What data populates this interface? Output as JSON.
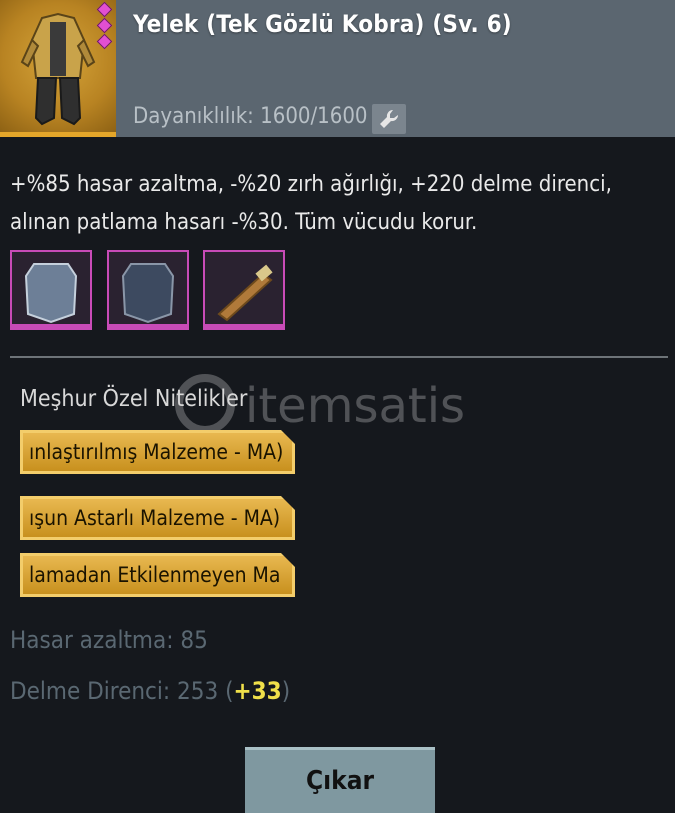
{
  "item": {
    "title": "Yelek (Tek Gözlü Kobra) (Sv. 6)",
    "durability": "Dayanıklılık: 1600/1600",
    "description": "+%85 hasar azaltma, -%20 zırh ağırlığı, +220 delme direnci, alınan patlama hasarı -%30. Tüm vücudu korur."
  },
  "attachments": [
    {
      "icon": "armor-plate-icon"
    },
    {
      "icon": "dark-armor-plate-icon"
    },
    {
      "icon": "strap-icon"
    }
  ],
  "perks": {
    "section_title": "Meşhur Özel Nitelikler",
    "items": [
      "ınlaştırılmış Malzeme - MA)",
      "ışun Astarlı Malzeme - MA)",
      "lamadan Etkilenmeyen Ma"
    ]
  },
  "stats": {
    "damage_reduction": "Hasar azaltma: 85",
    "penetration_prefix": "Delme Direnci: 253 (",
    "penetration_bonus": "+33",
    "penetration_suffix": ")"
  },
  "watermark": "itemsatis",
  "actions": {
    "remove_label": "Çıkar"
  },
  "colors": {
    "rarity": "#c84bb7",
    "gold": "#e8b850",
    "header": "#5b6670",
    "bonus": "#f0e04a"
  }
}
